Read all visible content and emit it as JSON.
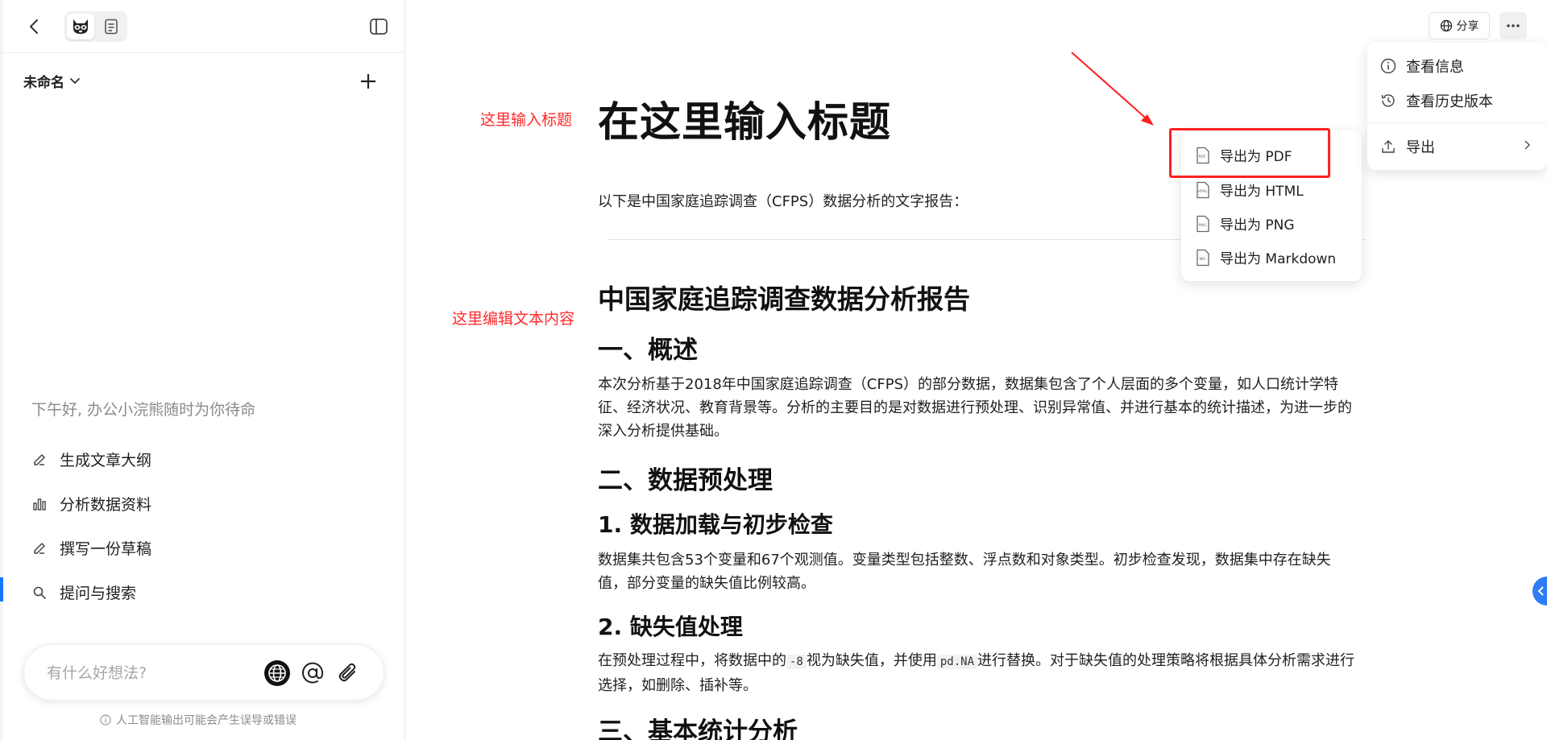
{
  "sidebar": {
    "doc_name": "未命名",
    "greeting": "下午好, 办公小浣熊随时为你待命",
    "quick_actions": [
      {
        "label": "生成文章大纲",
        "icon": "pencil-icon"
      },
      {
        "label": "分析数据资料",
        "icon": "bar-chart-icon"
      },
      {
        "label": "撰写一份草稿",
        "icon": "pencil-icon"
      },
      {
        "label": "提问与搜索",
        "icon": "search-icon"
      }
    ],
    "ask_placeholder": "有什么好想法?",
    "disclaimer": "人工智能输出可能会产生误导或错误"
  },
  "toolbar": {
    "share_label": "分享"
  },
  "annotations": {
    "title_hint": "这里输入标题",
    "content_hint": "这里编辑文本内容"
  },
  "document": {
    "title": "在这里输入标题",
    "intro": "以下是中国家庭追踪调查（CFPS）数据分析的文字报告：",
    "h1": "中国家庭追踪调查数据分析报告",
    "s1_heading": "一、概述",
    "s1_text": "本次分析基于2018年中国家庭追踪调查（CFPS）的部分数据，数据集包含了个人层面的多个变量，如人口统计学特征、经济状况、教育背景等。分析的主要目的是对数据进行预处理、识别异常值、并进行基本的统计描述，为进一步的深入分析提供基础。",
    "s2_heading": "二、数据预处理",
    "s2_1_heading": "1. 数据加载与初步检查",
    "s2_1_text": "数据集共包含53个变量和67个观测值。变量类型包括整数、浮点数和对象类型。初步检查发现，数据集中存在缺失值，部分变量的缺失值比例较高。",
    "s2_2_heading": "2. 缺失值处理",
    "s2_2_text_a": "在预处理过程中，将数据中的",
    "s2_2_code_a": "-8",
    "s2_2_text_b": "视为缺失值，并使用",
    "s2_2_code_b": "pd.NA",
    "s2_2_text_c": "进行替换。对于缺失值的处理策略将根据具体分析需求进行选择，如删除、插补等。",
    "s3_heading": "三、基本统计分析"
  },
  "export_menu": {
    "items": [
      {
        "label": "导出为 PDF",
        "icon_tag": "PDF"
      },
      {
        "label": "导出为 HTML",
        "icon_tag": "HTML"
      },
      {
        "label": "导出为 PNG",
        "icon_tag": "PNG"
      },
      {
        "label": "导出为 Markdown",
        "icon_tag": "MD"
      }
    ]
  },
  "more_menu": {
    "info": "查看信息",
    "history": "查看历史版本",
    "export": "导出"
  },
  "colors": {
    "annotation_red": "#ff2a2a",
    "accent_blue": "#1677ff"
  }
}
